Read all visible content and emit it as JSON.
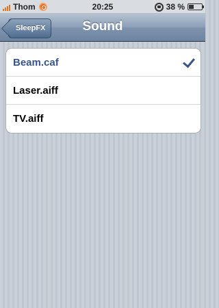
{
  "status_bar": {
    "carrier": "Thom",
    "time": "20:25",
    "battery_percent": "38 %",
    "battery_level": 0.38,
    "signal_bars": 4,
    "icons": [
      "signal-bars-icon",
      "carrier-app-icon",
      "rotation-lock-icon",
      "battery-icon"
    ],
    "accent_color": "#e0751d"
  },
  "navbar": {
    "back_label": "SleepFX",
    "title": "Sound"
  },
  "sounds": [
    {
      "label": "Beam.caf",
      "selected": true
    },
    {
      "label": "Laser.aiff",
      "selected": false
    },
    {
      "label": "TV.aiff",
      "selected": false
    }
  ],
  "colors": {
    "selected_text": "#385487",
    "background": "#c5ccd4"
  }
}
